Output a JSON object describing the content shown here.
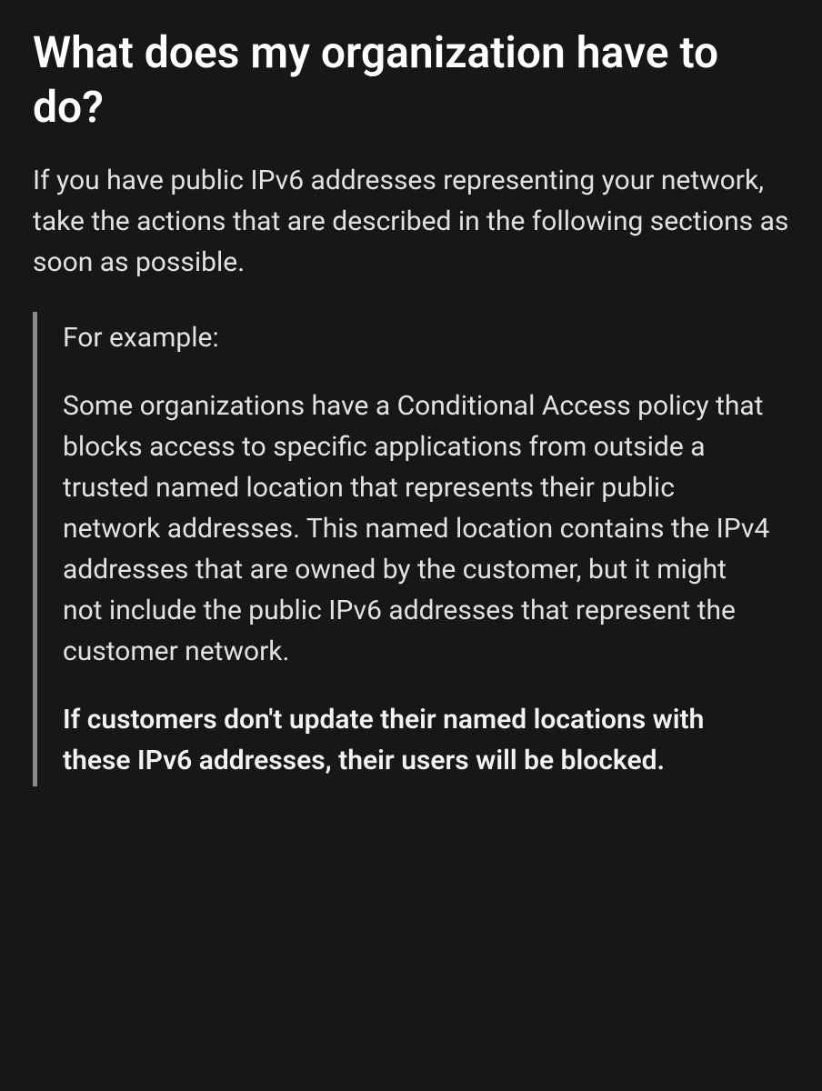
{
  "heading": "What does my organization have to do?",
  "intro": "If you have public IPv6 addresses representing your network, take the actions that are described in the following sections as soon as possible.",
  "example": {
    "label": "For example:",
    "body": "Some organizations have a Conditional Access policy that blocks access to specific applications from outside a trusted named location that represents their public network addresses. This named location contains the IPv4 addresses that are owned by the customer, but it might not include the public IPv6 addresses that represent the customer network.",
    "warning": "If customers don't update their named locations with these IPv6 addresses, their users will be blocked."
  }
}
